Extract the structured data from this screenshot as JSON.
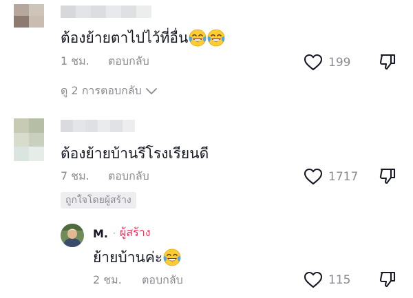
{
  "comments": [
    {
      "text": "ต้องย้ายตาไปไว้ที่อื่น",
      "emoji": [
        "joy-emoji",
        "joy-emoji"
      ],
      "time": "1 ชม.",
      "reply_label": "ตอบกลับ",
      "likes": "199",
      "view_replies": "ดู 2 การตอบกลับ"
    },
    {
      "text": "ต้องย้ายบ้านรึโรงเรียนดี",
      "time": "7 ชม.",
      "reply_label": "ตอบกลับ",
      "likes": "1717",
      "badge": "ถูกใจโดยผู้สร้าง",
      "reply": {
        "name": "M.",
        "separator": "·",
        "creator_label": "ผู้สร้าง",
        "text": "ย้ายบ้านค่ะ",
        "emoji": [
          "joy-emoji"
        ],
        "time": "2 ชม.",
        "reply_label": "ตอบกลับ",
        "likes": "115"
      }
    }
  ],
  "icons": {
    "like": "heart-outline-icon",
    "dislike": "thumbs-down-icon",
    "expand": "chevron-down-icon"
  },
  "colors": {
    "text": "#161823",
    "muted": "#8a8b91",
    "creator": "#fe2c55",
    "badge_bg": "#eeeef0"
  }
}
